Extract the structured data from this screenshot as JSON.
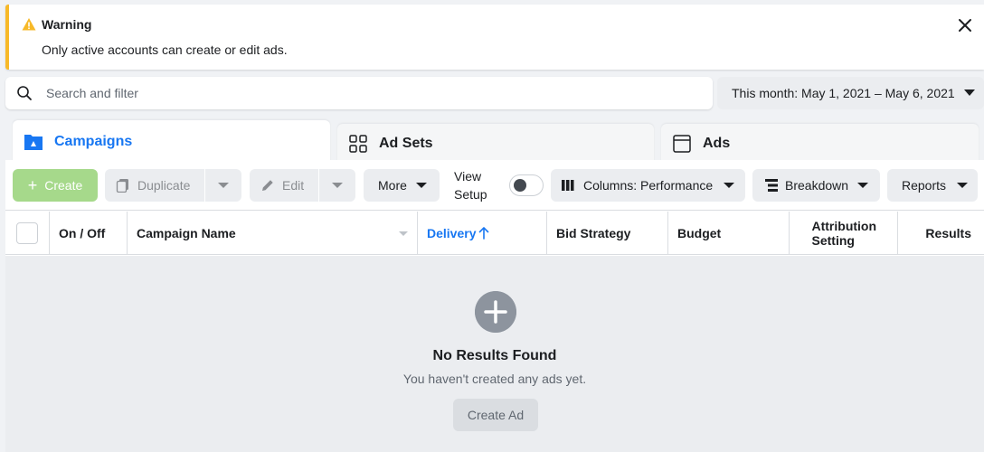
{
  "warning": {
    "title": "Warning",
    "message": "Only active accounts can create or edit ads."
  },
  "search": {
    "placeholder": "Search and filter"
  },
  "date_range": {
    "label": "This month: May 1, 2021 – May 6, 2021"
  },
  "tabs": [
    {
      "label": "Campaigns",
      "active": true,
      "icon": "folder-icon"
    },
    {
      "label": "Ad Sets",
      "active": false,
      "icon": "grid-icon"
    },
    {
      "label": "Ads",
      "active": false,
      "icon": "ad-window-icon"
    }
  ],
  "toolbar": {
    "create_label": "Create",
    "duplicate_label": "Duplicate",
    "edit_label": "Edit",
    "more_label": "More",
    "view_setup_line1": "View",
    "view_setup_line2": "Setup",
    "view_setup_on": false,
    "columns_label": "Columns: Performance",
    "breakdown_label": "Breakdown",
    "reports_label": "Reports"
  },
  "table": {
    "columns": [
      "On / Off",
      "Campaign Name",
      "Delivery",
      "Bid Strategy",
      "Budget",
      "Attribution Setting",
      "Results"
    ],
    "sorted_column": "Delivery",
    "sort_direction": "ascending"
  },
  "empty_state": {
    "title": "No Results Found",
    "subtitle": "You haven't created any ads yet.",
    "button_label": "Create Ad"
  },
  "colors": {
    "accent": "#1877f2",
    "warning": "#f7b928",
    "create_button": "#a6d98b"
  }
}
